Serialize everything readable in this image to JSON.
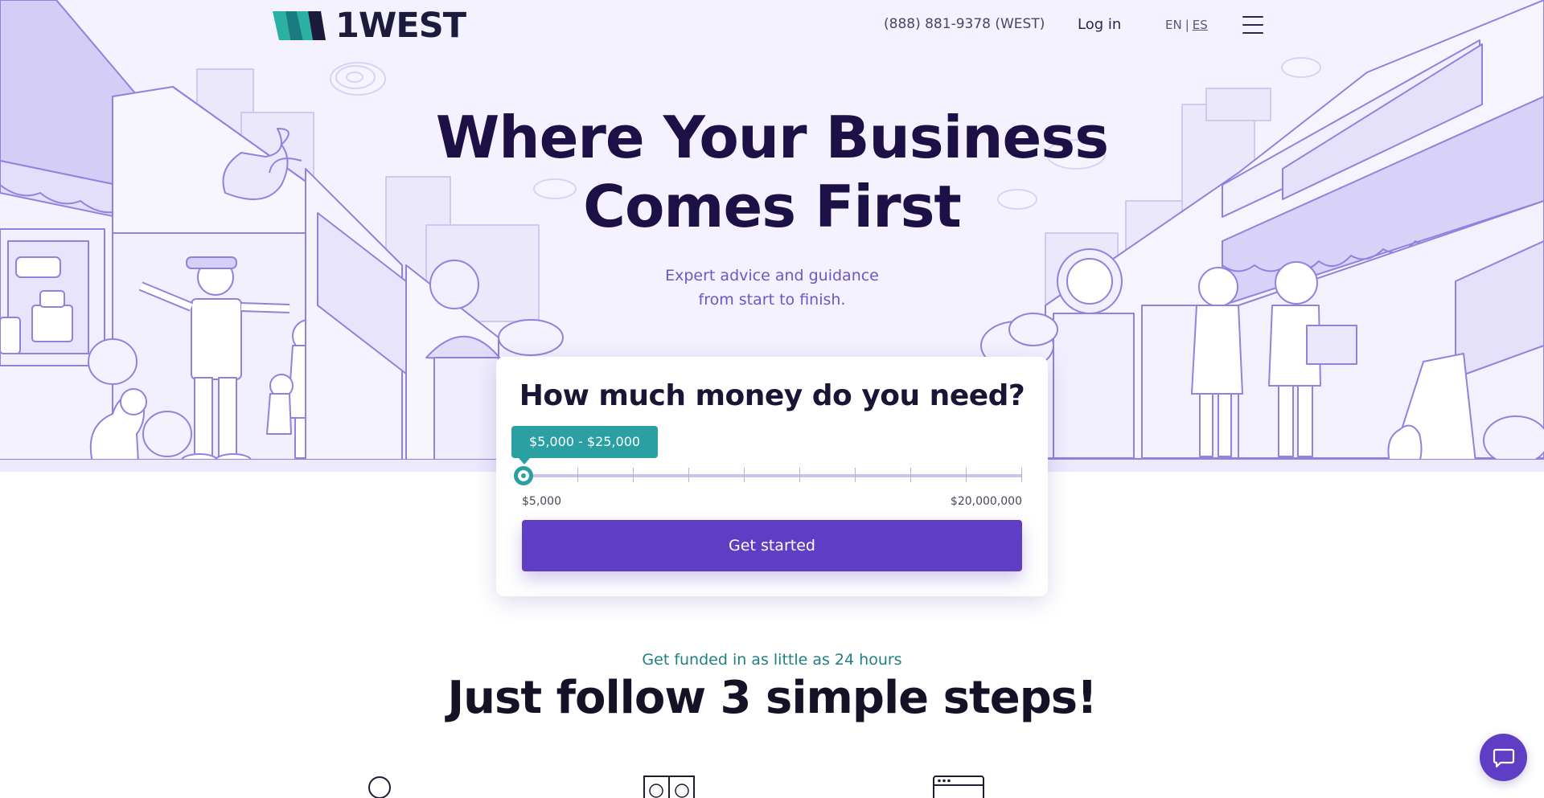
{
  "header": {
    "logo_text": "1WEST",
    "phone": "(888) 881-9378 (WEST)",
    "login_label": "Log in",
    "lang_en": "EN",
    "lang_sep": "|",
    "lang_es": "ES",
    "menu_icon": "hamburger-icon"
  },
  "hero": {
    "headline_line1": "Where Your Business",
    "headline_line2": "Comes First",
    "subhead_line1": "Expert advice and guidance",
    "subhead_line2": "from start to finish."
  },
  "amount_card": {
    "title": "How much money do you need?",
    "selected_range": "$5,000 - $25,000",
    "min_label": "$5,000",
    "max_label": "$20,000,000",
    "slider_position": 0,
    "cta_label": "Get started"
  },
  "steps": {
    "kicker": "Get funded in as little as 24 hours",
    "title": "Just follow 3 simple steps!",
    "icons": [
      "search-icon",
      "ab-compare-icon",
      "browser-window-icon"
    ]
  },
  "chat": {
    "icon": "chat-bubble-icon"
  },
  "colors": {
    "brand_purple": "#5f3dc4",
    "teal": "#2aa0a2",
    "hero_bg": "#f4f2fe",
    "headline": "#1c1046"
  }
}
